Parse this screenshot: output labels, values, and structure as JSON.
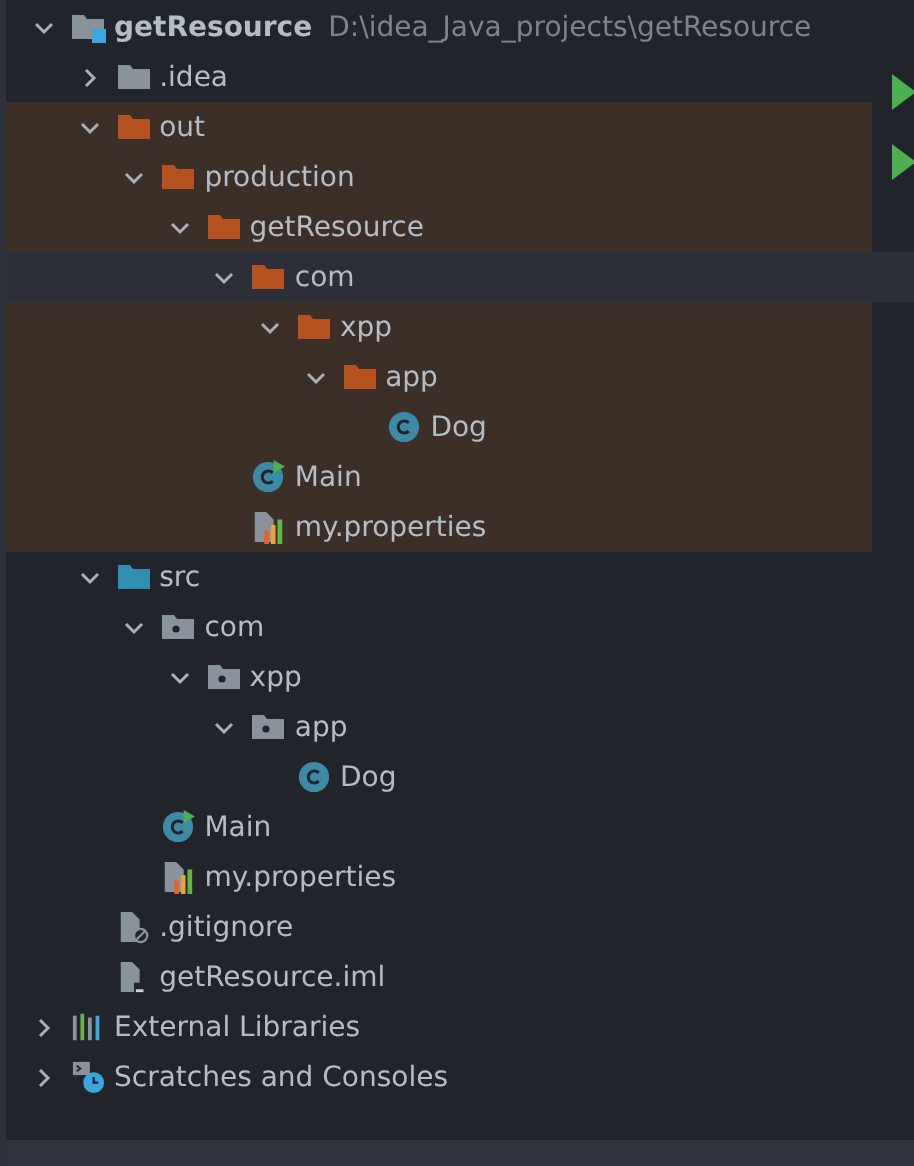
{
  "project_tree": {
    "items": [
      {
        "kind": "project",
        "name": "getResource",
        "path": "D:\\idea_Java_projects\\getResource",
        "expanded": true,
        "selected": false,
        "children": [
          {
            "kind": "folder",
            "name": ".idea",
            "expanded": false,
            "selected": false
          },
          {
            "kind": "excluded-folder",
            "name": "out",
            "expanded": true,
            "selected": false,
            "children": [
              {
                "kind": "output-folder",
                "name": "production",
                "expanded": true,
                "selected": false,
                "children": [
                  {
                    "kind": "output-folder",
                    "name": "getResource",
                    "expanded": true,
                    "selected": false,
                    "children": [
                      {
                        "kind": "output-folder",
                        "name": "com",
                        "expanded": true,
                        "selected": true,
                        "children": [
                          {
                            "kind": "output-folder",
                            "name": "xpp",
                            "expanded": true,
                            "selected": false,
                            "children": [
                              {
                                "kind": "output-folder",
                                "name": "app",
                                "expanded": true,
                                "selected": false,
                                "children": [
                                  {
                                    "kind": "class",
                                    "name": "Dog",
                                    "selected": false
                                  }
                                ]
                              }
                            ]
                          }
                        ]
                      },
                      {
                        "kind": "main-class",
                        "name": "Main",
                        "selected": false
                      },
                      {
                        "kind": "properties",
                        "name": "my.properties",
                        "selected": false
                      }
                    ]
                  }
                ]
              }
            ]
          },
          {
            "kind": "source-folder",
            "name": "src",
            "expanded": true,
            "selected": false,
            "children": [
              {
                "kind": "package",
                "name": "com",
                "expanded": true,
                "selected": false,
                "children": [
                  {
                    "kind": "package",
                    "name": "xpp",
                    "expanded": true,
                    "selected": false,
                    "children": [
                      {
                        "kind": "package",
                        "name": "app",
                        "expanded": true,
                        "selected": false,
                        "children": [
                          {
                            "kind": "class",
                            "name": "Dog",
                            "selected": false
                          }
                        ]
                      }
                    ]
                  }
                ]
              },
              {
                "kind": "main-class",
                "name": "Main",
                "selected": false
              },
              {
                "kind": "properties",
                "name": "my.properties",
                "selected": false
              }
            ]
          },
          {
            "kind": "gitignore",
            "name": ".gitignore",
            "selected": false
          },
          {
            "kind": "iml",
            "name": "getResource.iml",
            "selected": false
          }
        ]
      },
      {
        "kind": "libraries",
        "name": "External Libraries",
        "expanded": false,
        "selected": false
      },
      {
        "kind": "scratches",
        "name": "Scratches and Consoles",
        "expanded": false,
        "selected": false
      }
    ]
  }
}
